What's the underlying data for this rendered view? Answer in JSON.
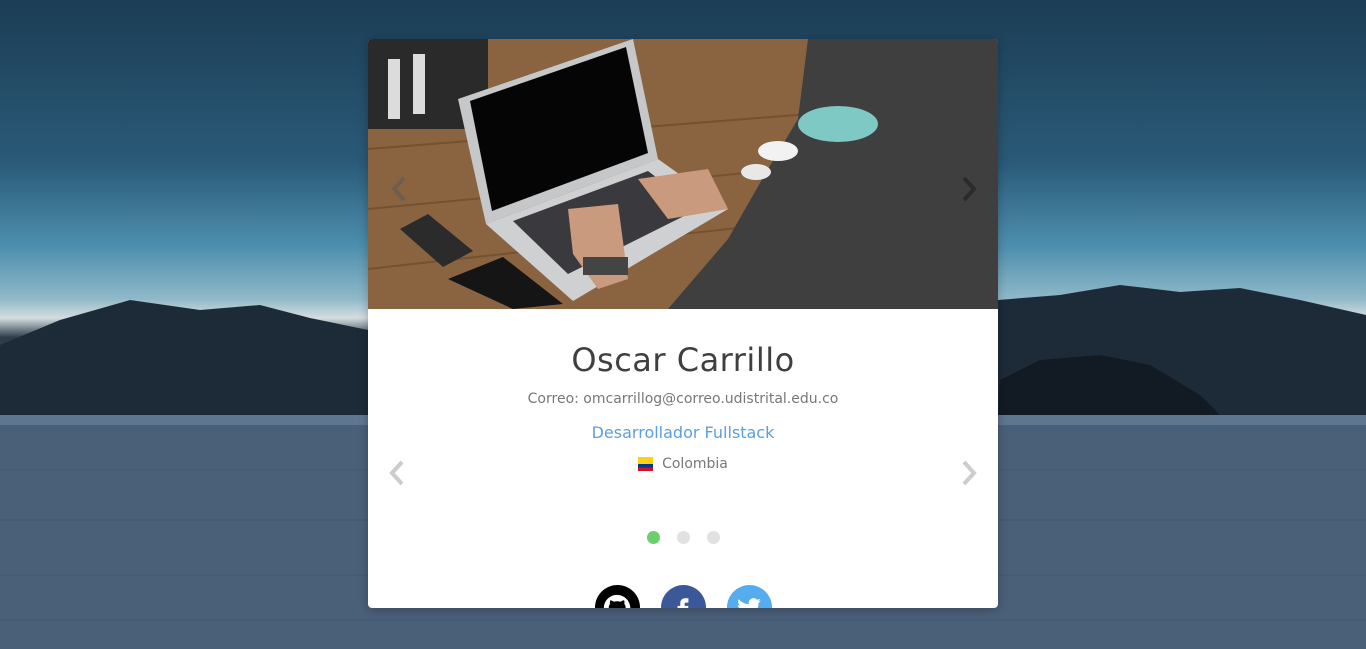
{
  "profile": {
    "name": "Oscar Carrillo",
    "email": "Correo: omcarrillog@correo.udistrital.edu.co",
    "role": "Desarrollador Fullstack",
    "country": "Colombia"
  },
  "carousel": {
    "total_slides": 3,
    "active_index": 0
  },
  "social": {
    "github_icon": "github-icon",
    "facebook_icon": "facebook-icon",
    "twitter_icon": "twitter-icon"
  },
  "colors": {
    "role_link": "#5b9fe0",
    "active_dot": "#6ccf6e",
    "inactive_dot": "#e1e1e1",
    "github": "#000000",
    "facebook": "#3b5998",
    "twitter": "#55acee"
  }
}
